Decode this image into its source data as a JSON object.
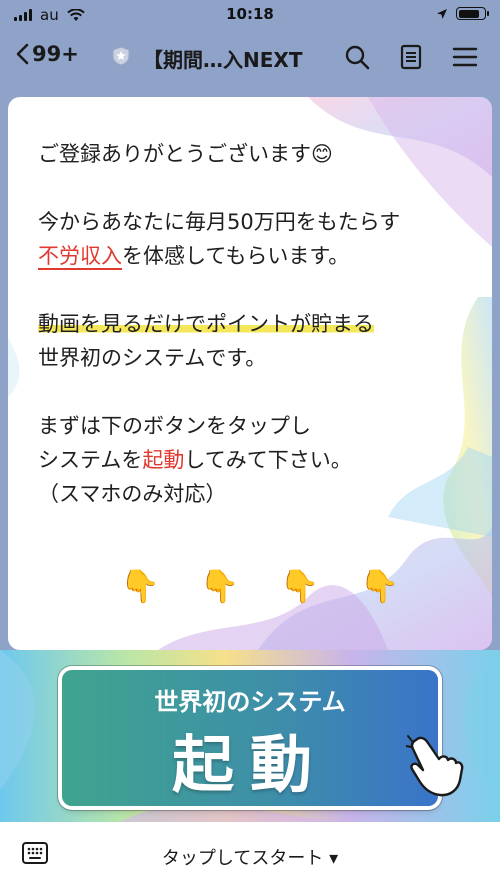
{
  "status_bar": {
    "carrier": "au",
    "time": "10:18",
    "battery_level": 0.85
  },
  "nav": {
    "back_count": "99+",
    "title": "【期間…入NEXT"
  },
  "message": {
    "line1": "ご登録ありがとうございます😊",
    "line2": "今からあなたに毎月50万円をもたらす",
    "line3_red": "不労収入",
    "line3_rest": "を体感してもらいます。",
    "line4": "動画を見るだけでポイントが貯まる",
    "line5": "世界初のシステムです。",
    "line6": "まずは下のボタンをタップし",
    "line7_pre": "システムを",
    "line7_red": "起動",
    "line7_post": "してみて下さい。",
    "line8": "（スマホのみ対応）",
    "hand_emoji": "👇"
  },
  "rich_menu": {
    "subtitle": "世界初のシステム",
    "main": "起動"
  },
  "bottom_bar": {
    "label": "タップしてスタート ▾"
  }
}
